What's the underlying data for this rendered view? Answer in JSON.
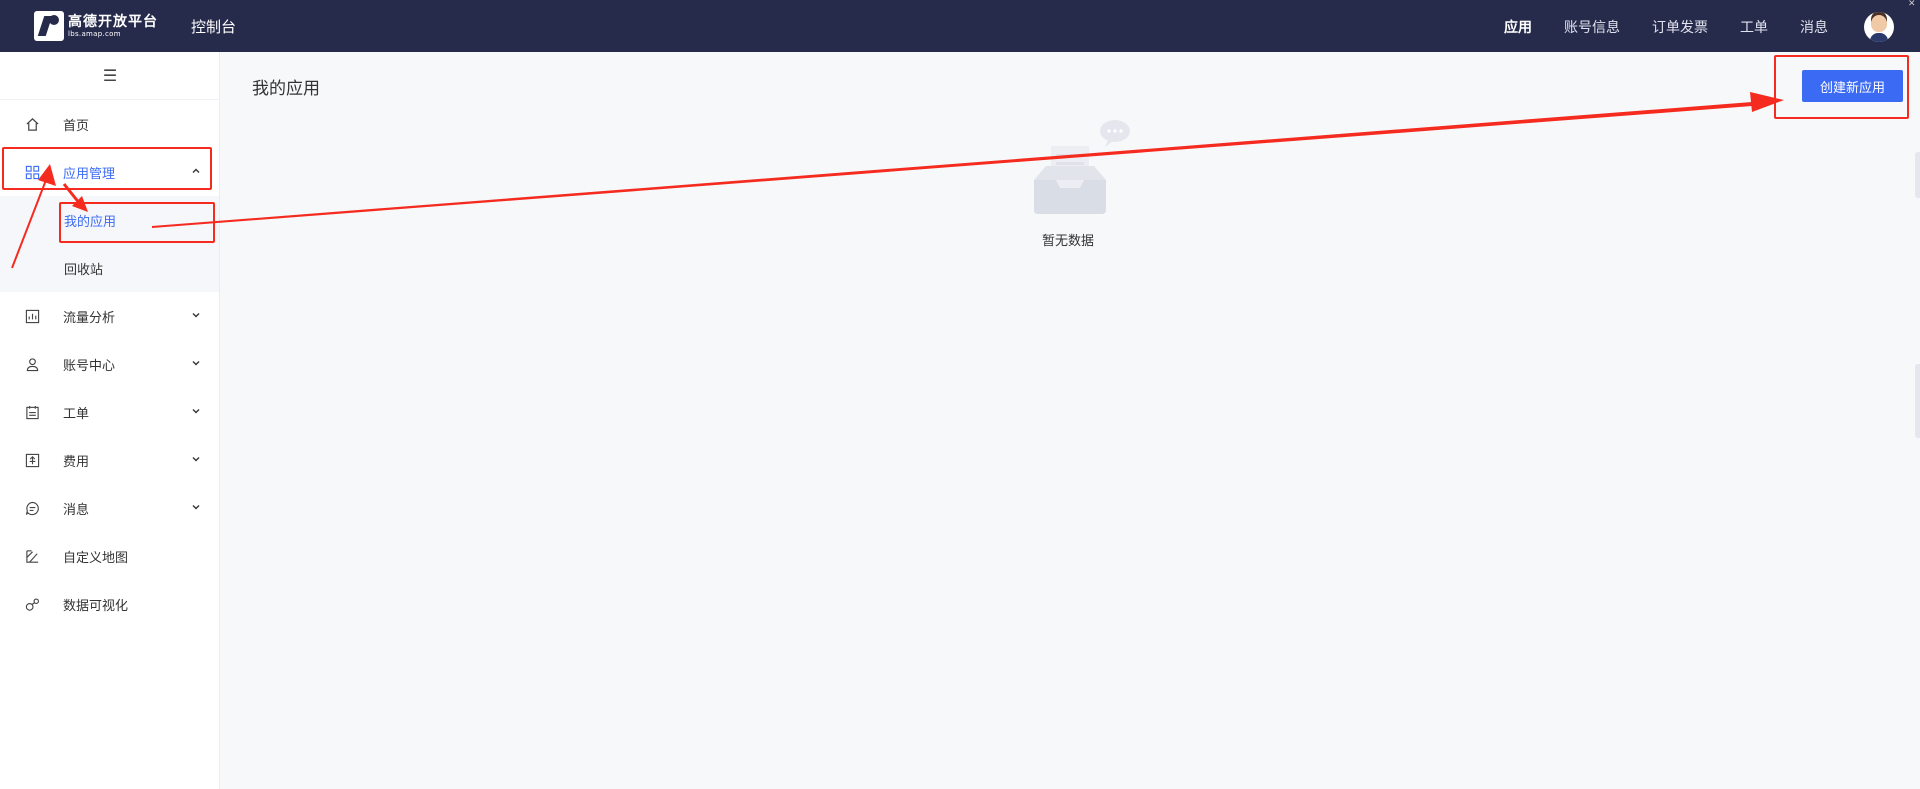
{
  "header": {
    "logo_title": "高德开放平台",
    "logo_sub": "lbs.amap.com",
    "console_title": "控制台",
    "nav": [
      "应用",
      "账号信息",
      "订单发票",
      "工单",
      "消息"
    ],
    "active_nav": "应用"
  },
  "sidebar": {
    "items": [
      {
        "label": "首页",
        "icon": "home-icon"
      },
      {
        "label": "应用管理",
        "icon": "apps-grid-icon",
        "expanded": true,
        "children": [
          {
            "label": "我的应用",
            "active": true
          },
          {
            "label": "回收站"
          }
        ]
      },
      {
        "label": "流量分析",
        "icon": "chart-icon"
      },
      {
        "label": "账号中心",
        "icon": "user-icon"
      },
      {
        "label": "工单",
        "icon": "clipboard-icon"
      },
      {
        "label": "费用",
        "icon": "billing-icon"
      },
      {
        "label": "消息",
        "icon": "message-icon"
      },
      {
        "label": "自定义地图",
        "icon": "map-icon"
      },
      {
        "label": "数据可视化",
        "icon": "visualization-icon"
      }
    ]
  },
  "main": {
    "page_title": "我的应用",
    "create_button": "创建新应用",
    "empty_text": "暂无数据"
  },
  "colors": {
    "header_bg": "#272b4b",
    "accent": "#3b6bf5",
    "annotation": "#f52b1f"
  }
}
